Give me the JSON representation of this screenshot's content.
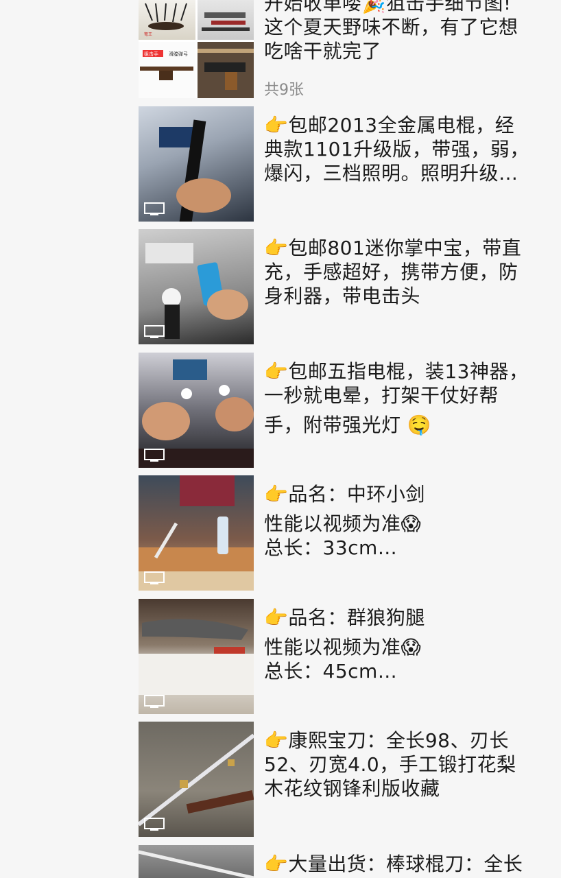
{
  "items": [
    {
      "text_lines": [
        "开始收单喽🎉狙击手细节图!",
        "这个夏天野味不断，有了它想",
        "吃啥干就完了"
      ],
      "count": "共9张",
      "collage_texts": [
        "弩王 · 304不锈钢打滑弓",
        "狙击手",
        "滑膛弹弓"
      ]
    },
    {
      "text_lines": [
        "👉包邮2013全金属电棍，经",
        "典款1101升级版，带强，弱，",
        "爆闪，三档照明。照明升级…"
      ]
    },
    {
      "text_lines": [
        "👉包邮801迷你掌中宝，带直",
        "充，手感超好，携带方便，防",
        "身利器，带电击头"
      ]
    },
    {
      "text_lines": [
        "👉包邮五指电棍，装13神器，",
        "一秒就电晕，打架干仗好帮",
        "手，附带强光灯 🤤"
      ]
    },
    {
      "text_lines": [
        "👉品名：中环小剑",
        "性能以视频为准😱",
        "总长：33cm…"
      ]
    },
    {
      "text_lines": [
        "👉品名：群狼狗腿",
        "性能以视频为准😱",
        "总长：45cm…"
      ]
    },
    {
      "text_lines": [
        "👉康熙宝刀：全长98、刃长",
        "52、刃宽4.0，手工锻打花梨",
        "木花纹钢锋利版收藏"
      ]
    },
    {
      "text_lines": [
        "👉大量出货：棒球棍刀：全长"
      ]
    }
  ],
  "icons": {
    "video": "video-icon",
    "pointer": "pointing-hand"
  }
}
